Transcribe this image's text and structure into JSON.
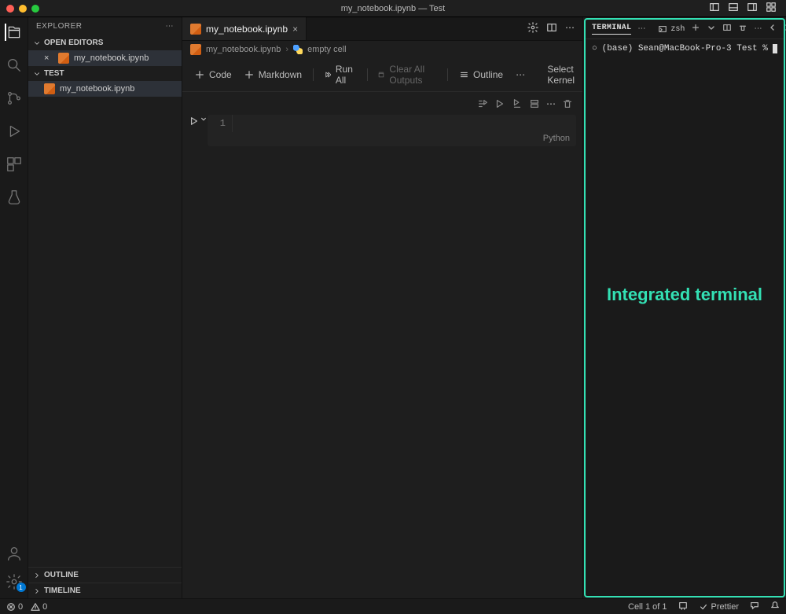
{
  "titlebar": {
    "title": "my_notebook.ipynb — Test"
  },
  "sidebar": {
    "title": "EXPLORER",
    "open_editors_label": "OPEN EDITORS",
    "open_editors": [
      {
        "name": "my_notebook.ipynb"
      }
    ],
    "workspace_label": "TEST",
    "files": [
      {
        "name": "my_notebook.ipynb"
      }
    ],
    "outline_label": "OUTLINE",
    "timeline_label": "TIMELINE"
  },
  "editor": {
    "tab": "my_notebook.ipynb",
    "breadcrumb_file": "my_notebook.ipynb",
    "breadcrumb_cell": "empty cell",
    "toolbar": {
      "code": "Code",
      "markdown": "Markdown",
      "runall": "Run All",
      "clear": "Clear All Outputs",
      "outline": "Outline",
      "kernel": "Select Kernel"
    },
    "cell": {
      "line_number": "1",
      "language": "Python"
    }
  },
  "terminal": {
    "title": "TERMINAL",
    "shell": "zsh",
    "prompt_prefix": "○",
    "prompt": "(base) Sean@MacBook-Pro-3 Test %",
    "annotation": "Integrated terminal"
  },
  "statusbar": {
    "errors": "0",
    "warnings": "0",
    "cell": "Cell 1 of 1",
    "prettier": "Prettier"
  }
}
